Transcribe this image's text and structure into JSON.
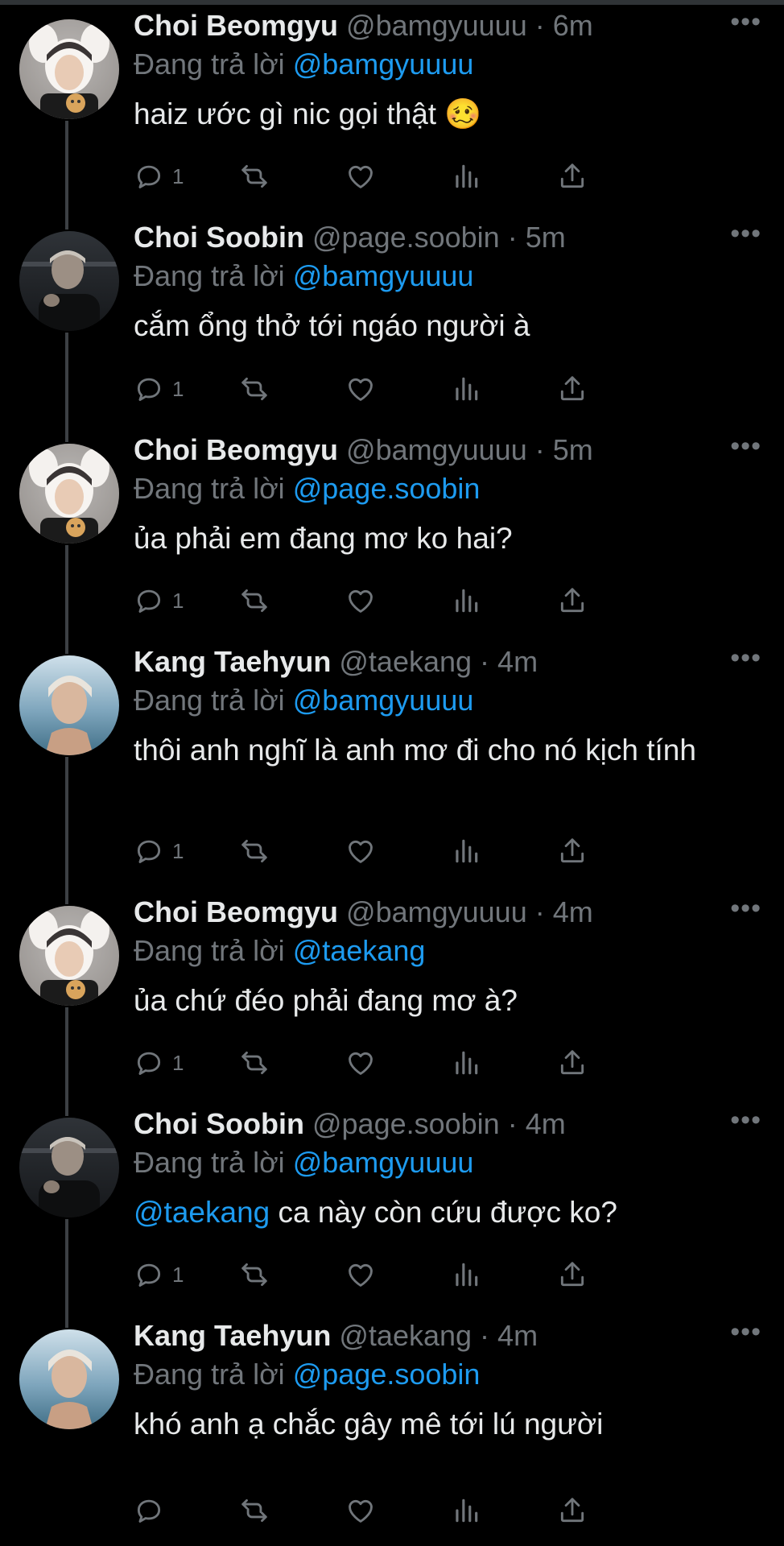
{
  "tweets": [
    {
      "name": "Choi Beomgyu",
      "handle": "@bamgyuuuu",
      "time": "6m",
      "reply_prefix": "Đang trả lời",
      "reply_to": "@bamgyuuuu",
      "text_mention": "",
      "text": "haiz ước gì nic gọi thật 🥴",
      "reply_count": "1",
      "avatar": "beomgyu"
    },
    {
      "name": "Choi Soobin",
      "handle": "@page.soobin",
      "time": "5m",
      "reply_prefix": "Đang trả lời",
      "reply_to": "@bamgyuuuu",
      "text_mention": "",
      "text": "cắm ổng thở tới ngáo người à",
      "reply_count": "1",
      "avatar": "soobin"
    },
    {
      "name": "Choi Beomgyu",
      "handle": "@bamgyuuuu",
      "time": "5m",
      "reply_prefix": "Đang trả lời",
      "reply_to": "@page.soobin",
      "text_mention": "",
      "text": "ủa phải em đang mơ ko hai?",
      "reply_count": "1",
      "avatar": "beomgyu"
    },
    {
      "name": "Kang Taehyun",
      "handle": "@taekang",
      "time": "4m",
      "reply_prefix": "Đang trả lời",
      "reply_to": "@bamgyuuuu",
      "text_mention": "",
      "text": "thôi anh nghĩ là anh mơ đi cho nó kịch tính",
      "reply_count": "1",
      "avatar": "taehyun"
    },
    {
      "name": "Choi Beomgyu",
      "handle": "@bamgyuuuu",
      "time": "4m",
      "reply_prefix": "Đang trả lời",
      "reply_to": "@taekang",
      "text_mention": "",
      "text": "ủa chứ đéo phải đang mơ à?",
      "reply_count": "1",
      "avatar": "beomgyu"
    },
    {
      "name": "Choi Soobin",
      "handle": "@page.soobin",
      "time": "4m",
      "reply_prefix": "Đang trả lời",
      "reply_to": "@bamgyuuuu",
      "text_mention": "@taekang",
      "text": " ca này còn cứu được ko?",
      "reply_count": "1",
      "avatar": "soobin"
    },
    {
      "name": "Kang Taehyun",
      "handle": "@taekang",
      "time": "4m",
      "reply_prefix": "Đang trả lời",
      "reply_to": "@page.soobin",
      "text_mention": "",
      "text": "khó anh ạ chắc gây mê tới lú người",
      "reply_count": "",
      "avatar": "taehyun"
    }
  ],
  "icons": {
    "reply": "reply-icon",
    "retweet": "retweet-icon",
    "like": "heart-icon",
    "views": "views-icon",
    "share": "share-icon",
    "more": "more-icon"
  },
  "colors": {
    "background": "#000000",
    "text": "#e7e9ea",
    "secondary": "#71767b",
    "mention": "#1d9bf0",
    "thread_line": "#3c4044"
  }
}
